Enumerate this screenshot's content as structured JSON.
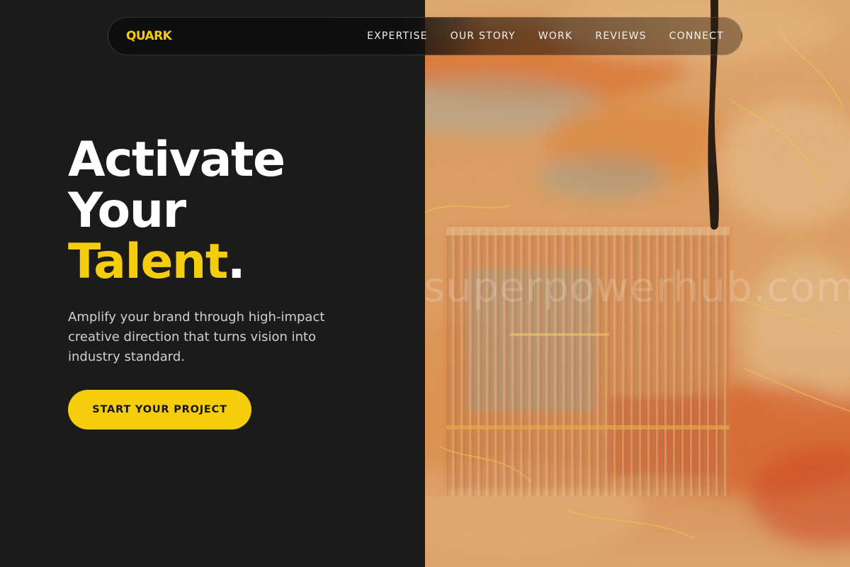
{
  "header": {
    "brand": "QUARK",
    "nav": [
      {
        "label": "EXPERTISE"
      },
      {
        "label": "OUR STORY"
      },
      {
        "label": "WORK"
      },
      {
        "label": "REVIEWS"
      },
      {
        "label": "CONNECT"
      }
    ]
  },
  "hero": {
    "title_line1": "Activate",
    "title_line2": "Your",
    "title_accent": "Talent",
    "title_dot": ".",
    "subtitle": "Amplify your brand through high-impact creative direction that turns vision into industry standard.",
    "cta_label": "START YOUR PROJECT"
  },
  "artwork": {
    "watermark": "superpowerhub.com"
  },
  "colors": {
    "background": "#1b1b1b",
    "accent": "#f5cd0c",
    "text": "#ffffff",
    "muted_text": "#cfcfcf"
  }
}
